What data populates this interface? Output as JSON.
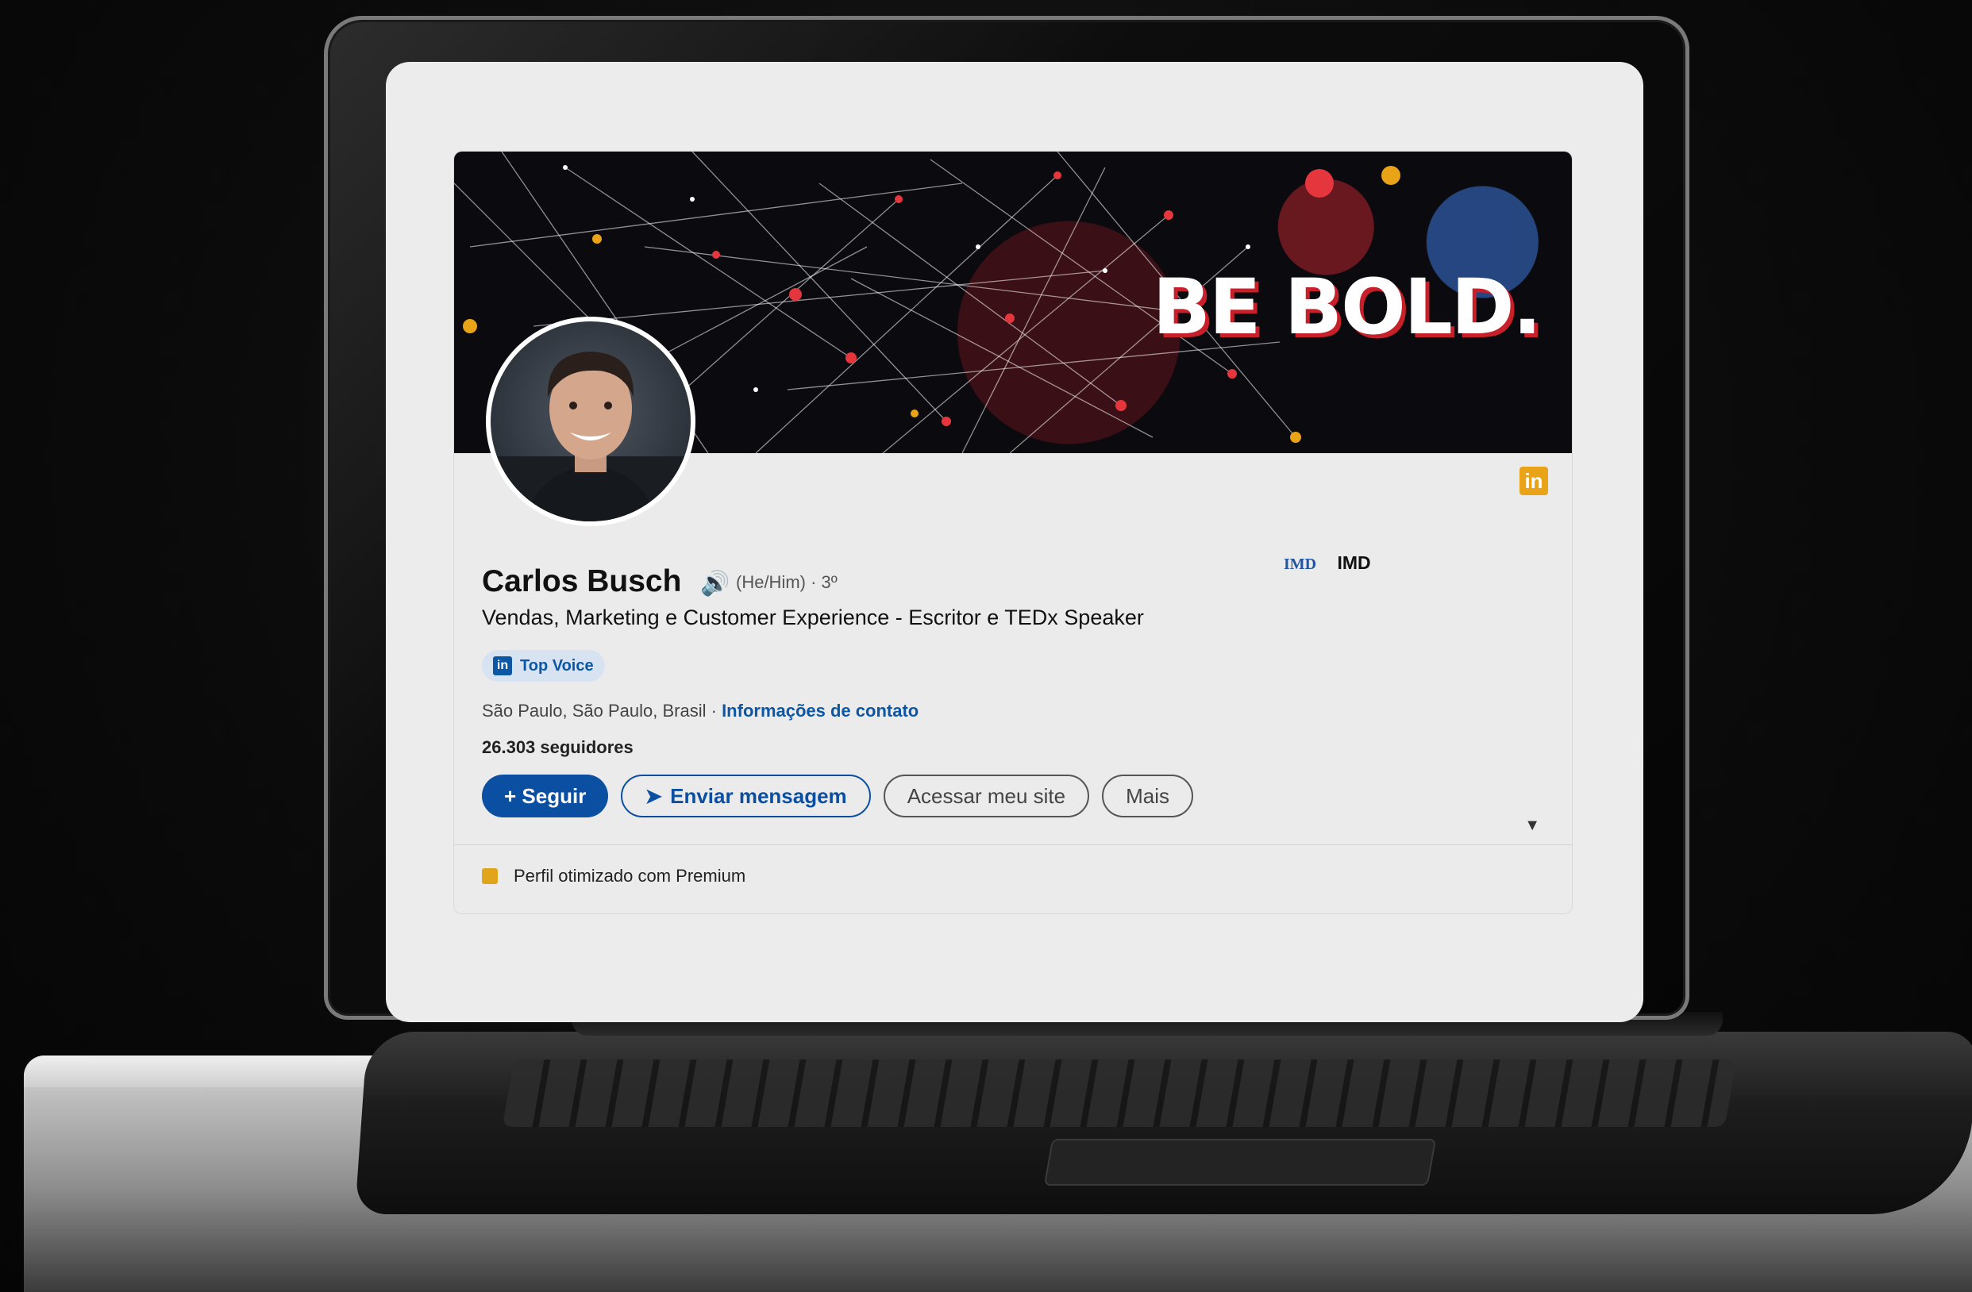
{
  "banner": {
    "slogan": "BE BOLD."
  },
  "profile": {
    "name": "Carlos Busch",
    "pronouns": "(He/Him) · 3º",
    "headline": "Vendas, Marketing e Customer Experience - Escritor e TEDx Speaker",
    "badge": "Top Voice",
    "badge_icon": "in",
    "location": "São Paulo, São Paulo, Brasil · ",
    "contact_link": "Informações de contato",
    "followers": "26.303 seguidores",
    "company_logo": "IMD",
    "company": "IMD"
  },
  "actions": {
    "follow": "+ Seguir",
    "message": "Enviar mensagem",
    "site": "Acessar meu site",
    "more": "Mais"
  },
  "footer": {
    "premium_label": "Perfil otimizado com Premium"
  },
  "corner_icon": "in",
  "colors": {
    "brand_blue": "#0b4fa3",
    "premium_gold": "#e0a51b",
    "banner_red": "#c8202a"
  }
}
